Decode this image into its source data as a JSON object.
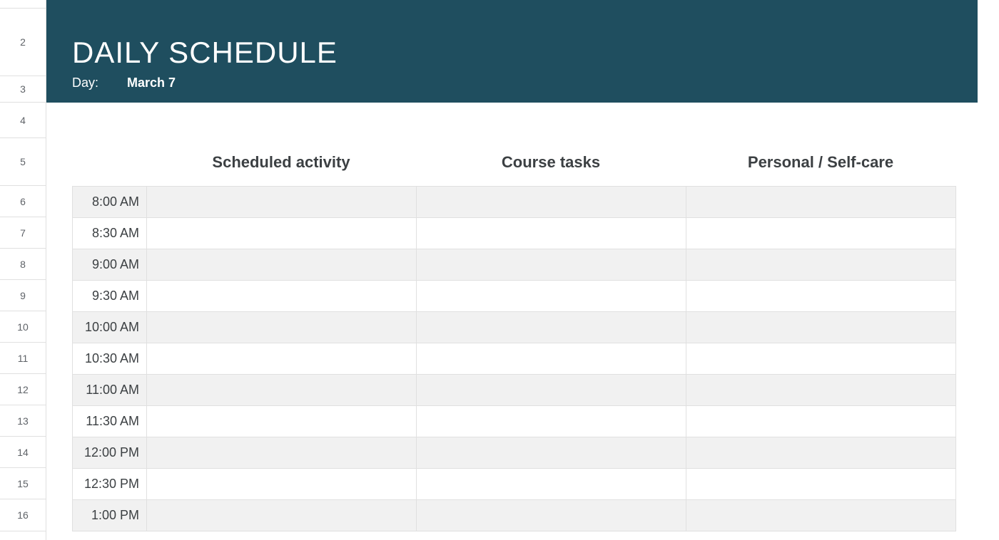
{
  "rowNumbers": [
    "2",
    "3",
    "4",
    "5",
    "6",
    "7",
    "8",
    "9",
    "10",
    "11",
    "12",
    "13",
    "14",
    "15",
    "16"
  ],
  "banner": {
    "title": "DAILY SCHEDULE",
    "dayLabel": "Day:",
    "dayValue": "March 7"
  },
  "columns": {
    "activity": "Scheduled activity",
    "tasks": "Course tasks",
    "personal": "Personal / Self-care"
  },
  "timeSlots": [
    {
      "time": "8:00 AM",
      "activity": "",
      "tasks": "",
      "personal": ""
    },
    {
      "time": "8:30 AM",
      "activity": "",
      "tasks": "",
      "personal": ""
    },
    {
      "time": "9:00 AM",
      "activity": "",
      "tasks": "",
      "personal": ""
    },
    {
      "time": "9:30 AM",
      "activity": "",
      "tasks": "",
      "personal": ""
    },
    {
      "time": "10:00 AM",
      "activity": "",
      "tasks": "",
      "personal": ""
    },
    {
      "time": "10:30 AM",
      "activity": "",
      "tasks": "",
      "personal": ""
    },
    {
      "time": "11:00 AM",
      "activity": "",
      "tasks": "",
      "personal": ""
    },
    {
      "time": "11:30 AM",
      "activity": "",
      "tasks": "",
      "personal": ""
    },
    {
      "time": "12:00 PM",
      "activity": "",
      "tasks": "",
      "personal": ""
    },
    {
      "time": "12:30 PM",
      "activity": "",
      "tasks": "",
      "personal": ""
    },
    {
      "time": "1:00 PM",
      "activity": "",
      "tasks": "",
      "personal": ""
    }
  ]
}
